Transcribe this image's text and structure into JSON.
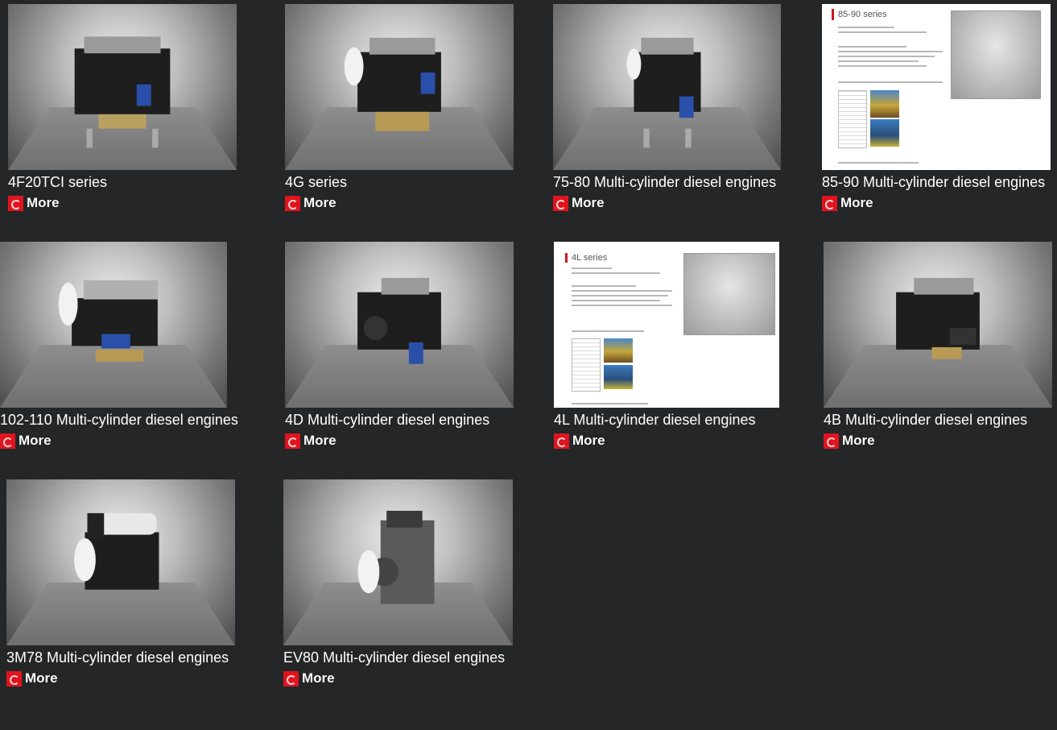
{
  "more_label": "More",
  "products": [
    {
      "title": "4F20TCI series"
    },
    {
      "title": "4G series"
    },
    {
      "title": "75-80 Multi-cylinder diesel engines"
    },
    {
      "title": "85-90 Multi-cylinder diesel engines",
      "sheet_title": "85-90 series"
    },
    {
      "title": "102-110 Multi-cylinder diesel engines"
    },
    {
      "title": "4D Multi-cylinder diesel engines"
    },
    {
      "title": "4L Multi-cylinder diesel engines",
      "sheet_title": "4L series"
    },
    {
      "title": "4B Multi-cylinder diesel engines"
    },
    {
      "title": "3M78 Multi-cylinder diesel engines"
    },
    {
      "title": "EV80 Multi-cylinder diesel engines"
    }
  ],
  "colors": {
    "background": "#252628",
    "accent": "#e0141e",
    "text": "#ffffff"
  }
}
